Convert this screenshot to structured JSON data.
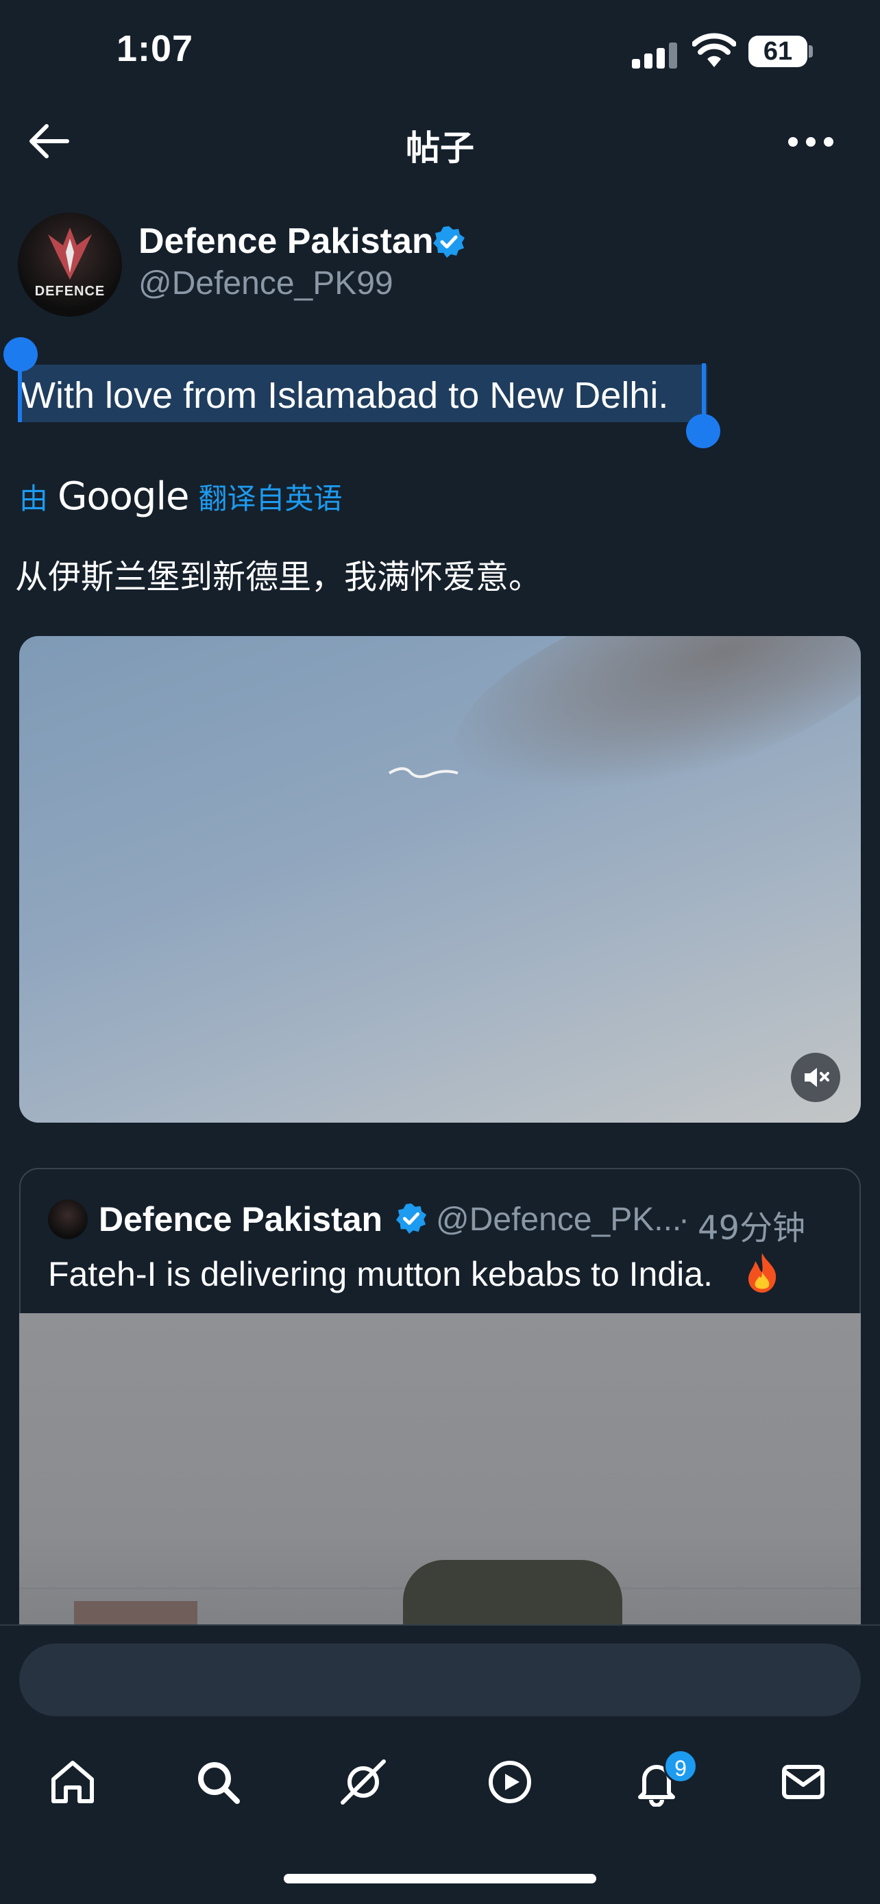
{
  "status_bar": {
    "time": "1:07",
    "battery": "61"
  },
  "header": {
    "title": "帖子"
  },
  "post": {
    "author": {
      "name": "Defence Pakistan",
      "handle": "@Defence_PK99",
      "avatar_text": "DEFENCE"
    },
    "text": "With love from Islamabad to New Delhi.",
    "translation": {
      "by_label": "由",
      "google_label": "Google",
      "link_label": "翻译自英语",
      "text": "从伊斯兰堡到新德里，我满怀爱意。"
    }
  },
  "quote": {
    "author": {
      "name": "Defence Pakistan",
      "handle": "@Defence_PK...",
      "separator": "·",
      "time": "49分钟"
    },
    "text": "Fateh-I is delivering mutton kebabs to India."
  },
  "reply": {
    "placeholder": ""
  },
  "tabs": [
    {
      "name": "home-icon"
    },
    {
      "name": "search-icon"
    },
    {
      "name": "grok-icon"
    },
    {
      "name": "video-icon"
    },
    {
      "name": "notifications-icon",
      "badge": "9"
    },
    {
      "name": "messages-icon"
    }
  ],
  "colors": {
    "accent": "#1d9bf0",
    "background": "#15202b",
    "selection": "#1f3d5e",
    "muted": "#8b98a5"
  }
}
